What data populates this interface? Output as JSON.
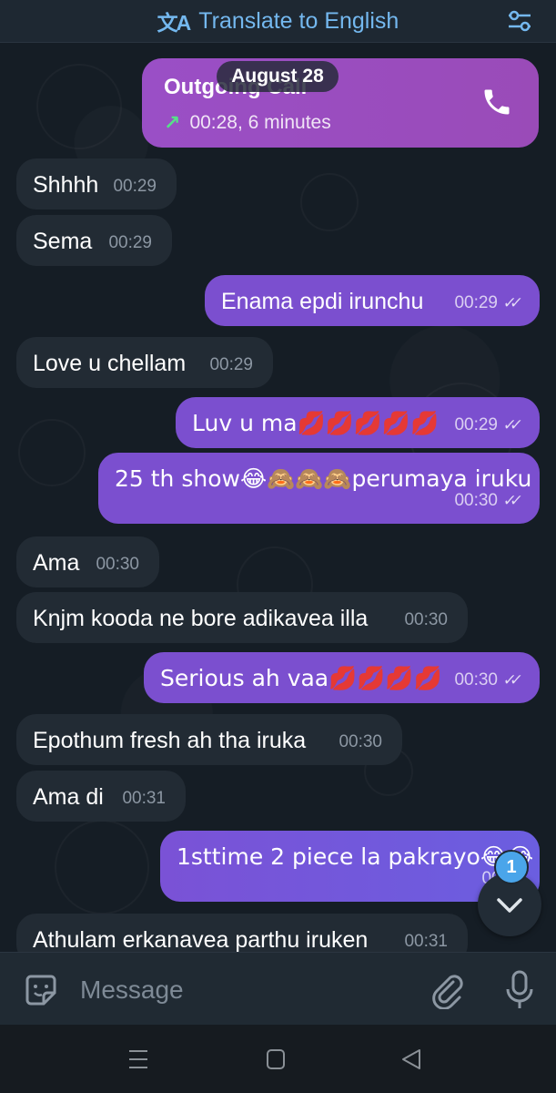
{
  "topbar": {
    "translate_label": "Translate to English"
  },
  "date_separator": "August 28",
  "call": {
    "title": "Outgoing Call",
    "detail": "00:28, 6 minutes"
  },
  "messages": [
    {
      "dir": "in",
      "text": "Shhhh",
      "time": "00:29"
    },
    {
      "dir": "in",
      "text": "Sema",
      "time": "00:29"
    },
    {
      "dir": "out",
      "text": "Enama epdi irunchu",
      "time": "00:29"
    },
    {
      "dir": "in",
      "text": "Love u chellam",
      "time": "00:29"
    },
    {
      "dir": "out",
      "text": "Luv u ma💋💋💋💋💋",
      "time": "00:29"
    },
    {
      "dir": "out",
      "text": "25 th show😂🙈🙈🙈perumaya iruku",
      "time": "00:30"
    },
    {
      "dir": "in",
      "text": "Ama",
      "time": "00:30"
    },
    {
      "dir": "in",
      "text": "Knjm kooda ne bore adikavea illa",
      "time": "00:30"
    },
    {
      "dir": "out",
      "text": "Serious ah vaa💋💋💋💋",
      "time": "00:30"
    },
    {
      "dir": "in",
      "text": "Epothum fresh ah tha iruka",
      "time": "00:30"
    },
    {
      "dir": "in",
      "text": "Ama di",
      "time": "00:31"
    },
    {
      "dir": "out",
      "text": "1sttime 2 piece la pakrayo😂😂",
      "time": "00:31"
    },
    {
      "dir": "in",
      "text": "Athulam erkanavea parthu iruken",
      "time": "00:31"
    }
  ],
  "scroll": {
    "unread_count": "1"
  },
  "composer": {
    "placeholder": "Message"
  },
  "colors": {
    "incoming": "#222b34",
    "outgoing": "#7b4fcf",
    "accent": "#74b8ef",
    "badge": "#4aa5ea"
  },
  "icons": [
    "translate-icon",
    "filter-icon",
    "phone-icon",
    "chevron-down-icon",
    "sticker-icon",
    "attach-icon",
    "mic-icon",
    "menu-icon",
    "home-icon",
    "back-icon"
  ]
}
